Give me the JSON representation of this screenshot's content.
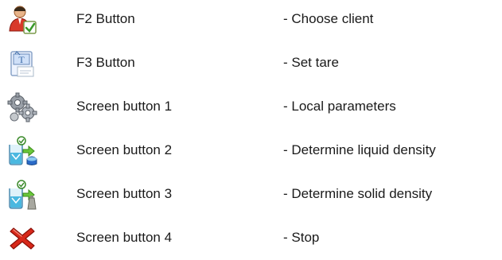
{
  "rows": [
    {
      "icon": "client-icon",
      "button": "F2 Button",
      "description": "- Choose client"
    },
    {
      "icon": "tare-icon",
      "button": "F3 Button",
      "description": "- Set tare"
    },
    {
      "icon": "gears-icon",
      "button": "Screen button 1",
      "description": "- Local parameters"
    },
    {
      "icon": "liquid-density-icon",
      "button": "Screen button 2",
      "description": "- Determine liquid density"
    },
    {
      "icon": "solid-density-icon",
      "button": "Screen button 3",
      "description": "- Determine solid density"
    },
    {
      "icon": "stop-icon",
      "button": "Screen button 4",
      "description": "- Stop"
    }
  ]
}
